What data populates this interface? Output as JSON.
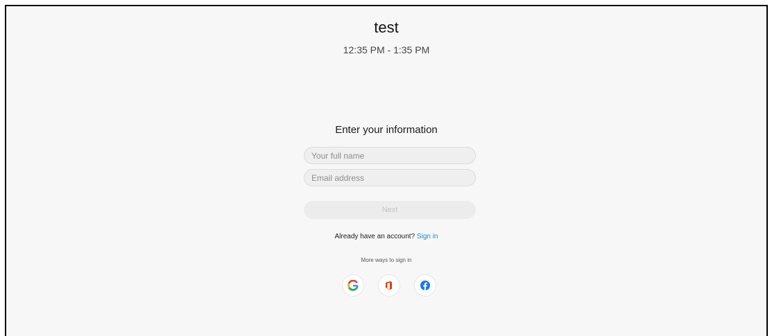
{
  "meeting": {
    "title": "test",
    "time_range": "12:35 PM - 1:35 PM"
  },
  "form": {
    "heading": "Enter your information",
    "name_field": {
      "placeholder": "Your full name",
      "value": ""
    },
    "email_field": {
      "placeholder": "Email address",
      "value": ""
    },
    "next_label": "Next"
  },
  "account": {
    "prompt": "Already have an account?",
    "sign_in_label": "Sign in"
  },
  "alternate_sign_in": {
    "label": "More ways to sign in",
    "providers": [
      {
        "name": "google-icon",
        "color": "#4285F4"
      },
      {
        "name": "office-icon",
        "color": "#EB3C00"
      },
      {
        "name": "facebook-icon",
        "color": "#1877F2"
      }
    ]
  },
  "colors": {
    "background": "#f7f7f7",
    "link": "#1b87d6",
    "field_background": "#efefef",
    "disabled_button": "#ececec"
  }
}
